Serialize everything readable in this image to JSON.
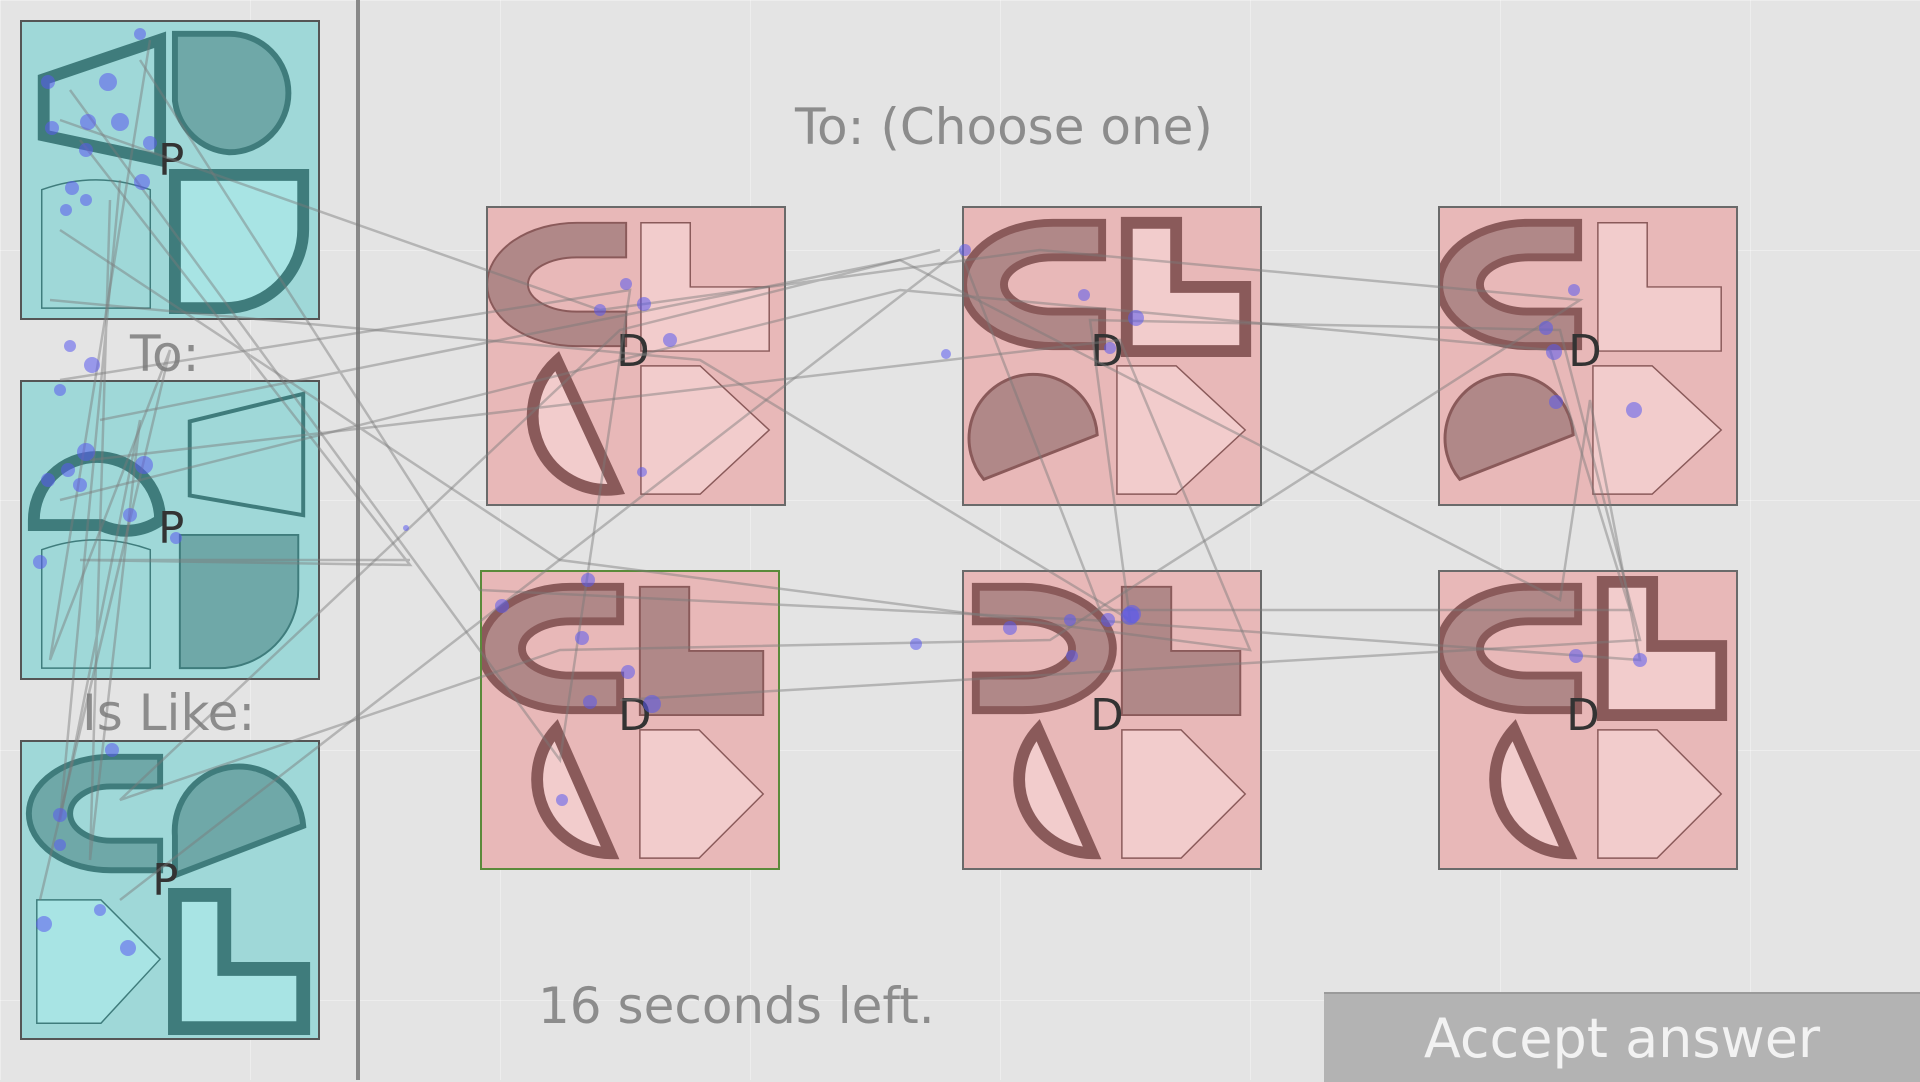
{
  "labels": {
    "to_choose": "To: (Choose one)",
    "to": "To:",
    "is_like": "Is Like:",
    "timer": "16 seconds left.",
    "accept": "Accept answer"
  },
  "cards": {
    "source_1_letter": "P",
    "source_2_letter": "P",
    "source_3_letter": "P",
    "option_letter": "D"
  },
  "colors": {
    "source_bg": "#9fd8d8",
    "source_shape": "#3f7c7c",
    "option_bg": "#e8b8b8",
    "option_shape": "#8a5a5a",
    "selected_border": "#5a8a3a",
    "gaze_dot": "#5a5aee"
  },
  "icons": {
    "shapes": [
      "trapezoid",
      "d-shape",
      "quarter-circle",
      "cup",
      "half-circle",
      "l-shape",
      "pentagon-arrow",
      "c-shape"
    ]
  }
}
